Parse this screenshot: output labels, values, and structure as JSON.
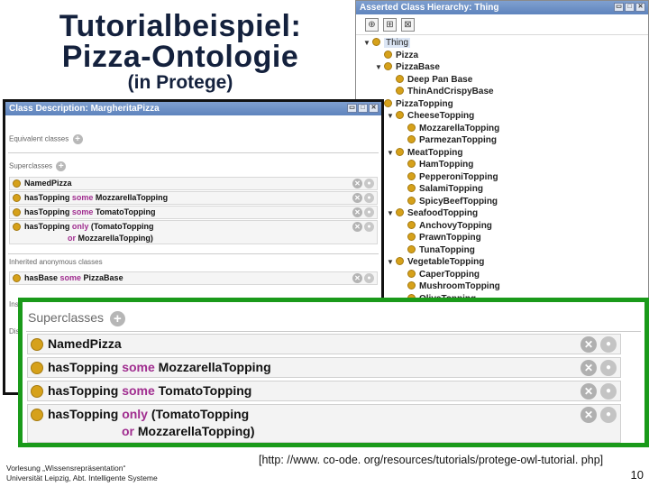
{
  "slide": {
    "title_line1": "Tutorialbeispiel:",
    "title_line2": "Pizza-Ontologie",
    "subtitle": "(in Protege)",
    "footer_line1": "Vorlesung „Wissensrepräsentation“",
    "footer_line2": "Universität Leipzig, Abt. Intelligente Systeme",
    "source_url": "[http: //www. co-ode. org/resources/tutorials/protege-owl-tutorial. php]",
    "page_number": "10"
  },
  "hierarchy": {
    "title": "Asserted Class Hierarchy: Thing",
    "items": [
      {
        "label": "Thing",
        "depth": 0,
        "expanded": true
      },
      {
        "label": "Pizza",
        "depth": 1,
        "expanded": null
      },
      {
        "label": "PizzaBase",
        "depth": 1,
        "expanded": true
      },
      {
        "label": "Deep Pan Base",
        "depth": 2,
        "expanded": null
      },
      {
        "label": "ThinAndCrispyBase",
        "depth": 2,
        "expanded": null
      },
      {
        "label": "PizzaTopping",
        "depth": 1,
        "expanded": true
      },
      {
        "label": "CheeseTopping",
        "depth": 2,
        "expanded": true
      },
      {
        "label": "MozzarellaTopping",
        "depth": 3,
        "expanded": null
      },
      {
        "label": "ParmezanTopping",
        "depth": 3,
        "expanded": null
      },
      {
        "label": "MeatTopping",
        "depth": 2,
        "expanded": true
      },
      {
        "label": "HamTopping",
        "depth": 3,
        "expanded": null
      },
      {
        "label": "PepperoniTopping",
        "depth": 3,
        "expanded": null
      },
      {
        "label": "SalamiTopping",
        "depth": 3,
        "expanded": null
      },
      {
        "label": "SpicyBeefTopping",
        "depth": 3,
        "expanded": null
      },
      {
        "label": "SeafoodTopping",
        "depth": 2,
        "expanded": true
      },
      {
        "label": "AnchovyTopping",
        "depth": 3,
        "expanded": null
      },
      {
        "label": "PrawnTopping",
        "depth": 3,
        "expanded": null
      },
      {
        "label": "TunaTopping",
        "depth": 3,
        "expanded": null
      },
      {
        "label": "VegetableTopping",
        "depth": 2,
        "expanded": true
      },
      {
        "label": "CaperTopping",
        "depth": 3,
        "expanded": null
      },
      {
        "label": "MushroomTopping",
        "depth": 3,
        "expanded": null
      },
      {
        "label": "OliveTopping",
        "depth": 3,
        "expanded": null
      }
    ]
  },
  "description": {
    "title": "Class Description: MargheritaPizza",
    "equivalent_label": "Equivalent classes",
    "superclasses_label": "Superclasses",
    "inherited_label": "Inherited anonymous classes",
    "truncated_label_1": "Ins",
    "truncated_label_2": "Dis",
    "superclasses": [
      {
        "parts": [
          {
            "t": "NamedPizza",
            "k": "n"
          }
        ]
      },
      {
        "parts": [
          {
            "t": "hasTopping ",
            "k": "n"
          },
          {
            "t": "some",
            "k": "kw"
          },
          {
            "t": " MozzarellaTopping",
            "k": "n"
          }
        ]
      },
      {
        "parts": [
          {
            "t": "hasTopping ",
            "k": "n"
          },
          {
            "t": "some",
            "k": "kw"
          },
          {
            "t": " TomatoTopping",
            "k": "n"
          }
        ]
      },
      {
        "parts": [
          {
            "t": "hasTopping ",
            "k": "n"
          },
          {
            "t": "only",
            "k": "kw"
          },
          {
            "t": " (TomatoTopping",
            "k": "n"
          }
        ],
        "line2": [
          {
            "t": "or",
            "k": "kw"
          },
          {
            "t": " MozzarellaTopping)",
            "k": "n"
          }
        ]
      }
    ],
    "inherited": [
      {
        "parts": [
          {
            "t": "hasBase ",
            "k": "n"
          },
          {
            "t": "some",
            "k": "kw"
          },
          {
            "t": " PizzaBase",
            "k": "n"
          }
        ]
      }
    ]
  },
  "zoom": {
    "label": "Superclasses",
    "rows": [
      {
        "parts": [
          {
            "t": "NamedPizza",
            "k": "n"
          }
        ]
      },
      {
        "parts": [
          {
            "t": "hasTopping ",
            "k": "n"
          },
          {
            "t": "some",
            "k": "kw"
          },
          {
            "t": " MozzarellaTopping",
            "k": "n"
          }
        ]
      },
      {
        "parts": [
          {
            "t": "hasTopping ",
            "k": "n"
          },
          {
            "t": "some",
            "k": "kw"
          },
          {
            "t": " TomatoTopping",
            "k": "n"
          }
        ]
      },
      {
        "parts": [
          {
            "t": "hasTopping ",
            "k": "n"
          },
          {
            "t": "only",
            "k": "kw"
          },
          {
            "t": " (TomatoTopping",
            "k": "n"
          }
        ],
        "line2": [
          {
            "t": "or",
            "k": "kw"
          },
          {
            "t": " MozzarellaTopping)",
            "k": "n"
          }
        ]
      }
    ]
  },
  "icons": {
    "class_icon": "class-circle-icon",
    "delete_icon": "delete-icon",
    "edit_icon": "edit-icon",
    "add_icon": "add-icon",
    "add_subclass": "add-subclass-icon",
    "add_sibling": "add-sibling-icon",
    "delete_class": "delete-class-icon"
  },
  "colors": {
    "title": "#14213d",
    "keyword": "#a02d8f",
    "class_icon": "#d6a11a",
    "zoom_border": "#1a9a1a",
    "header": "#6f92c7"
  }
}
